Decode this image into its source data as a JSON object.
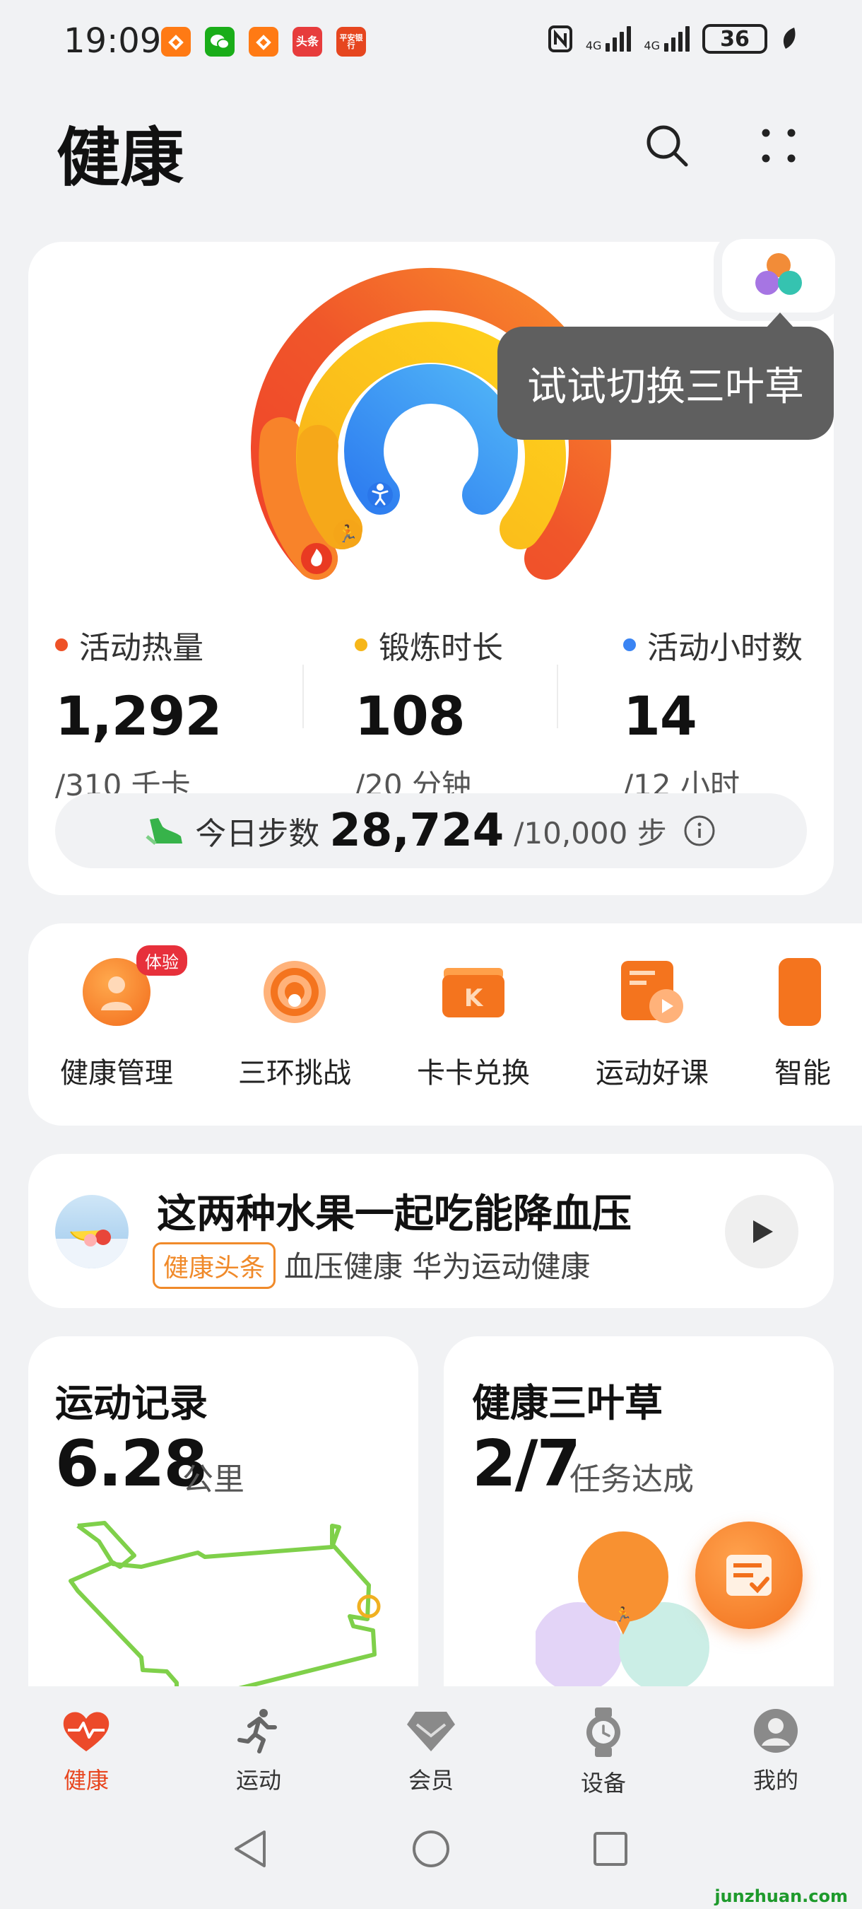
{
  "status_bar": {
    "time": "19:09",
    "apps": [
      {
        "name": "taobao-app-icon",
        "label": "",
        "color": "#ff7a14"
      },
      {
        "name": "wechat-app-icon",
        "label": "",
        "color": "#1aad19"
      },
      {
        "name": "taobao-app-icon-2",
        "label": "",
        "color": "#ff7a14"
      },
      {
        "name": "toutiao-app-icon",
        "label": "头条",
        "color": "#e73c3c"
      },
      {
        "name": "pingan-bank-app-icon",
        "label": "平安银行",
        "color": "#e6461f"
      }
    ],
    "network_1": "4G",
    "network_2": "4G",
    "battery": "36"
  },
  "header": {
    "title": "健康",
    "search_icon": "search-icon",
    "more_icon": "more-dots-icon"
  },
  "activity": {
    "tooltip": "试试切换三叶草",
    "rings": {
      "calories_progress": 1.0,
      "exercise_progress": 1.0,
      "hours_progress": 1.0
    },
    "stats": [
      {
        "label": "活动热量",
        "value": "1,292",
        "goal": "/310 千卡",
        "color": "#ee5227"
      },
      {
        "label": "锻炼时长",
        "value": "108",
        "goal": "/20 分钟",
        "color": "#f6b619"
      },
      {
        "label": "活动小时数",
        "value": "14",
        "goal": "/12 小时",
        "color": "#3a84f3"
      }
    ],
    "steps": {
      "label": "今日步数",
      "value": "28,724",
      "goal": "/10,000 步"
    }
  },
  "quick_access": [
    {
      "label": "健康管理",
      "badge": "体验",
      "color": "#f57c24"
    },
    {
      "label": "三环挑战",
      "badge": "",
      "color": "#f57c24"
    },
    {
      "label": "卡卡兑换",
      "badge": "",
      "color": "#f57c24"
    },
    {
      "label": "运动好课",
      "badge": "",
      "color": "#f57c24"
    },
    {
      "label": "智能",
      "badge": "",
      "color": "#f57c24"
    }
  ],
  "article": {
    "title": "这两种水果一起吃能降血压",
    "tag": "健康头条",
    "source": "血压健康 华为运动健康"
  },
  "exercise_record": {
    "title": "运动记录",
    "value": "6.28",
    "unit": "公里"
  },
  "health_clover": {
    "title": "健康三叶草",
    "value": "2/7",
    "unit": "任务达成"
  },
  "tabs": [
    {
      "label": "健康",
      "active": true
    },
    {
      "label": "运动",
      "active": false
    },
    {
      "label": "会员",
      "active": false
    },
    {
      "label": "设备",
      "active": false
    },
    {
      "label": "我的",
      "active": false
    }
  ],
  "watermark": "junzhuan.com",
  "colors": {
    "accent": "#e8461f",
    "ring_red": "#ee5227",
    "ring_yellow": "#f6b619",
    "ring_blue": "#3a84f3"
  }
}
